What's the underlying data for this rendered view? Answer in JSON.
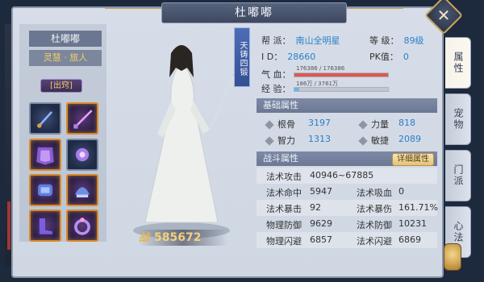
{
  "window": {
    "title": "杜嘟嘟",
    "close_icon": "close-x-icon"
  },
  "left": {
    "name": "杜嘟嘟",
    "title": "灵慧 · 旅人",
    "status": "[出窍]",
    "slots": [
      {
        "icon": "weapon-dagger-icon"
      },
      {
        "icon": "weapon-blade-icon"
      },
      {
        "icon": "armor-icon"
      },
      {
        "icon": "orb-amulet-icon"
      },
      {
        "icon": "bracer-icon"
      },
      {
        "icon": "helmet-icon"
      },
      {
        "icon": "boots-icon"
      },
      {
        "icon": "ring-icon"
      }
    ]
  },
  "character": {
    "rank_badge": "天铸四锻",
    "power_prefix": "战",
    "power": "585672"
  },
  "info": {
    "faction_label": "帮  派：",
    "faction": "南山全明星",
    "level_label": "等  级：",
    "level": "89级",
    "id_label": "I  D：",
    "id": "28660",
    "pk_label": "PK值：",
    "pk": "0",
    "hp_label": "气  血：",
    "hp_text": "176386 / 176386",
    "hp_ratio": 1.0,
    "exp_label": "经  验：",
    "exp_text": "186万 / 3761万",
    "exp_ratio": 0.05
  },
  "basic": {
    "header": "基础属性",
    "items": [
      {
        "label": "根骨",
        "value": "3197"
      },
      {
        "label": "力量",
        "value": "818"
      },
      {
        "label": "智力",
        "value": "1313"
      },
      {
        "label": "敏捷",
        "value": "2089"
      }
    ]
  },
  "combat": {
    "header": "战斗属性",
    "detail_button": "详细属性",
    "rows": [
      {
        "l1": "法术攻击",
        "v1": "40946~67885",
        "l2": "",
        "v2": ""
      },
      {
        "l1": "法术命中",
        "v1": "5947",
        "l2": "法术吸血",
        "v2": "0"
      },
      {
        "l1": "法术暴击",
        "v1": "92",
        "l2": "法术暴伤",
        "v2": "161.71%"
      },
      {
        "l1": "物理防御",
        "v1": "9629",
        "l2": "法术防御",
        "v2": "10231"
      },
      {
        "l1": "物理闪避",
        "v1": "6857",
        "l2": "法术闪避",
        "v2": "6869"
      }
    ]
  },
  "tabs": [
    {
      "label": "属性",
      "active": true
    },
    {
      "label": "宠物",
      "active": false
    },
    {
      "label": "门派",
      "active": false
    },
    {
      "label": "心法",
      "active": false
    }
  ],
  "colors": {
    "hp_bar": "#e0584f",
    "exp_bar": "#6fb3e8",
    "value_blue": "#2a7fc8",
    "gold": "#f3d17a"
  }
}
